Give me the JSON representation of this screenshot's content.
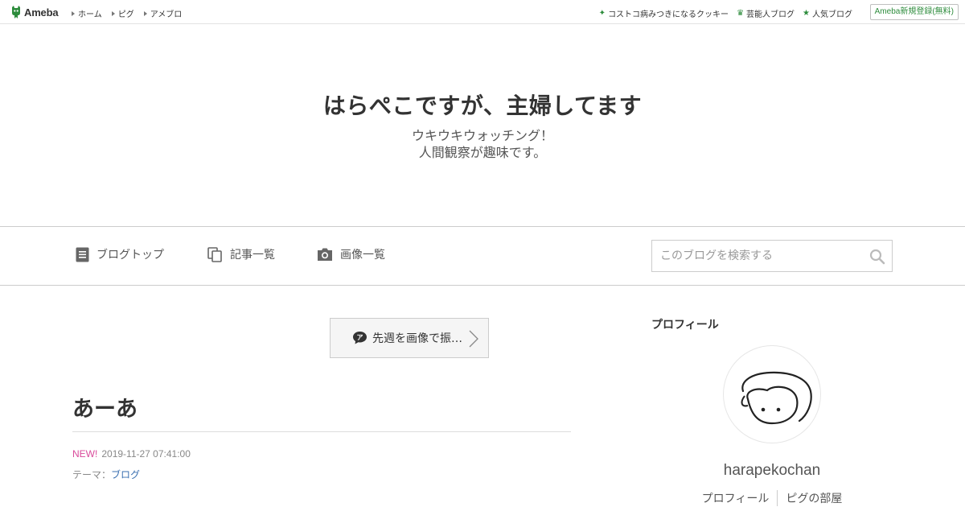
{
  "topbar": {
    "logo_text": "Ameba",
    "nav": [
      "ホーム",
      "ピグ",
      "アメブロ"
    ],
    "right_links": [
      {
        "label": "コストコ病みつきになるクッキー",
        "icon": "sparkle-icon"
      },
      {
        "label": "芸能人ブログ",
        "icon": "crown-icon"
      },
      {
        "label": "人気ブログ",
        "icon": "star-icon"
      }
    ],
    "signup_label": "Ameba新規登録(無料)"
  },
  "header": {
    "title": "はらぺこですが、主婦してます",
    "description_line1": "ウキウキウォッチング！",
    "description_line2": "人間観察が趣味です。"
  },
  "nav": {
    "blog_top": "ブログトップ",
    "entry_list": "記事一覧",
    "image_list": "画像一覧"
  },
  "search": {
    "placeholder": "このブログを検索する"
  },
  "main": {
    "theme_button_label": "先週を画像で振…",
    "entry": {
      "title": "あーあ",
      "new_label": "NEW!",
      "datetime": "2019-11-27 07:41:00",
      "theme_prefix": "テーマ：",
      "theme_link": "ブログ"
    }
  },
  "sidebar": {
    "heading": "プロフィール",
    "username": "harapekochan",
    "links": [
      "プロフィール",
      "ピグの部屋"
    ]
  },
  "colors": {
    "brand_green": "#2d8c3c",
    "new_badge": "#d94a9b",
    "link_blue": "#3a6fb0"
  }
}
